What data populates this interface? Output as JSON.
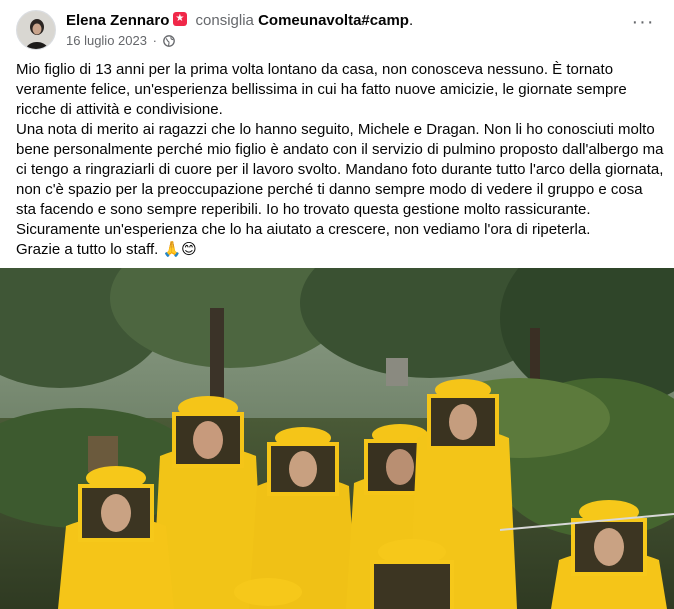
{
  "post": {
    "author": "Elena Zennaro",
    "action": "consiglia",
    "page": "Comeunavolta#camp",
    "page_suffix": ".",
    "date": "16 luglio 2023",
    "separator": "·",
    "audience_icon": "globe-icon",
    "more_icon": "more-options-icon",
    "more_symbol": "···",
    "badge_icon": "recommend-badge-icon",
    "badge_color": "#f02849",
    "body": "Mio figlio di 13 anni per la prima volta lontano da casa, non conosceva nessuno. È tornato veramente felice, un'esperienza bellissima in cui ha fatto nuove amicizie, le giornate sempre ricche di attività e condivisione.\nUna nota di merito ai ragazzi che lo hanno seguito, Michele e Dragan. Non li ho conosciuti molto bene personalmente perché mio figlio è andato con il servizio di pulmino proposto dall'albergo ma ci tengo a ringraziarli di cuore per il lavoro svolto. Mandano foto durante tutto l'arco della giornata, non c'è spazio per la preoccupazione perché ti danno sempre modo di vedere il gruppo e cosa sta facendo e sono sempre reperibili. Io ho trovato questa gestione molto rassicurante. Sicuramente un'esperienza che lo ha aiutato a crescere, non vediamo l'ora di ripeterla.\nGrazie a tutto lo staff. 🙏😊",
    "photo_main_color": "#f5c518"
  }
}
